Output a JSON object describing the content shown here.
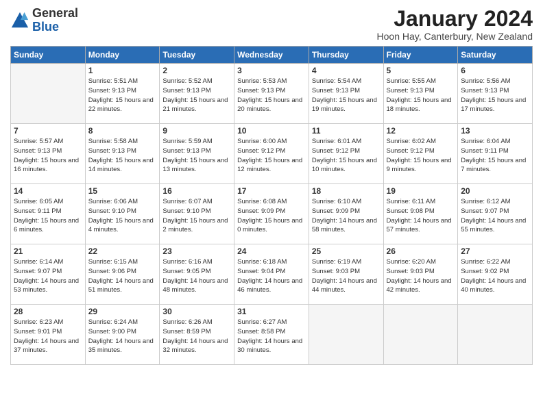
{
  "header": {
    "logo_general": "General",
    "logo_blue": "Blue",
    "month_year": "January 2024",
    "location": "Hoon Hay, Canterbury, New Zealand"
  },
  "days_of_week": [
    "Sunday",
    "Monday",
    "Tuesday",
    "Wednesday",
    "Thursday",
    "Friday",
    "Saturday"
  ],
  "weeks": [
    [
      {
        "num": "",
        "empty": true
      },
      {
        "num": "1",
        "sunrise": "5:51 AM",
        "sunset": "9:13 PM",
        "daylight": "15 hours and 22 minutes."
      },
      {
        "num": "2",
        "sunrise": "5:52 AM",
        "sunset": "9:13 PM",
        "daylight": "15 hours and 21 minutes."
      },
      {
        "num": "3",
        "sunrise": "5:53 AM",
        "sunset": "9:13 PM",
        "daylight": "15 hours and 20 minutes."
      },
      {
        "num": "4",
        "sunrise": "5:54 AM",
        "sunset": "9:13 PM",
        "daylight": "15 hours and 19 minutes."
      },
      {
        "num": "5",
        "sunrise": "5:55 AM",
        "sunset": "9:13 PM",
        "daylight": "15 hours and 18 minutes."
      },
      {
        "num": "6",
        "sunrise": "5:56 AM",
        "sunset": "9:13 PM",
        "daylight": "15 hours and 17 minutes."
      }
    ],
    [
      {
        "num": "7",
        "sunrise": "5:57 AM",
        "sunset": "9:13 PM",
        "daylight": "15 hours and 16 minutes."
      },
      {
        "num": "8",
        "sunrise": "5:58 AM",
        "sunset": "9:13 PM",
        "daylight": "15 hours and 14 minutes."
      },
      {
        "num": "9",
        "sunrise": "5:59 AM",
        "sunset": "9:13 PM",
        "daylight": "15 hours and 13 minutes."
      },
      {
        "num": "10",
        "sunrise": "6:00 AM",
        "sunset": "9:12 PM",
        "daylight": "15 hours and 12 minutes."
      },
      {
        "num": "11",
        "sunrise": "6:01 AM",
        "sunset": "9:12 PM",
        "daylight": "15 hours and 10 minutes."
      },
      {
        "num": "12",
        "sunrise": "6:02 AM",
        "sunset": "9:12 PM",
        "daylight": "15 hours and 9 minutes."
      },
      {
        "num": "13",
        "sunrise": "6:04 AM",
        "sunset": "9:11 PM",
        "daylight": "15 hours and 7 minutes."
      }
    ],
    [
      {
        "num": "14",
        "sunrise": "6:05 AM",
        "sunset": "9:11 PM",
        "daylight": "15 hours and 6 minutes."
      },
      {
        "num": "15",
        "sunrise": "6:06 AM",
        "sunset": "9:10 PM",
        "daylight": "15 hours and 4 minutes."
      },
      {
        "num": "16",
        "sunrise": "6:07 AM",
        "sunset": "9:10 PM",
        "daylight": "15 hours and 2 minutes."
      },
      {
        "num": "17",
        "sunrise": "6:08 AM",
        "sunset": "9:09 PM",
        "daylight": "15 hours and 0 minutes."
      },
      {
        "num": "18",
        "sunrise": "6:10 AM",
        "sunset": "9:09 PM",
        "daylight": "14 hours and 58 minutes."
      },
      {
        "num": "19",
        "sunrise": "6:11 AM",
        "sunset": "9:08 PM",
        "daylight": "14 hours and 57 minutes."
      },
      {
        "num": "20",
        "sunrise": "6:12 AM",
        "sunset": "9:07 PM",
        "daylight": "14 hours and 55 minutes."
      }
    ],
    [
      {
        "num": "21",
        "sunrise": "6:14 AM",
        "sunset": "9:07 PM",
        "daylight": "14 hours and 53 minutes."
      },
      {
        "num": "22",
        "sunrise": "6:15 AM",
        "sunset": "9:06 PM",
        "daylight": "14 hours and 51 minutes."
      },
      {
        "num": "23",
        "sunrise": "6:16 AM",
        "sunset": "9:05 PM",
        "daylight": "14 hours and 48 minutes."
      },
      {
        "num": "24",
        "sunrise": "6:18 AM",
        "sunset": "9:04 PM",
        "daylight": "14 hours and 46 minutes."
      },
      {
        "num": "25",
        "sunrise": "6:19 AM",
        "sunset": "9:03 PM",
        "daylight": "14 hours and 44 minutes."
      },
      {
        "num": "26",
        "sunrise": "6:20 AM",
        "sunset": "9:03 PM",
        "daylight": "14 hours and 42 minutes."
      },
      {
        "num": "27",
        "sunrise": "6:22 AM",
        "sunset": "9:02 PM",
        "daylight": "14 hours and 40 minutes."
      }
    ],
    [
      {
        "num": "28",
        "sunrise": "6:23 AM",
        "sunset": "9:01 PM",
        "daylight": "14 hours and 37 minutes."
      },
      {
        "num": "29",
        "sunrise": "6:24 AM",
        "sunset": "9:00 PM",
        "daylight": "14 hours and 35 minutes."
      },
      {
        "num": "30",
        "sunrise": "6:26 AM",
        "sunset": "8:59 PM",
        "daylight": "14 hours and 32 minutes."
      },
      {
        "num": "31",
        "sunrise": "6:27 AM",
        "sunset": "8:58 PM",
        "daylight": "14 hours and 30 minutes."
      },
      {
        "num": "",
        "empty": true
      },
      {
        "num": "",
        "empty": true
      },
      {
        "num": "",
        "empty": true
      }
    ]
  ]
}
